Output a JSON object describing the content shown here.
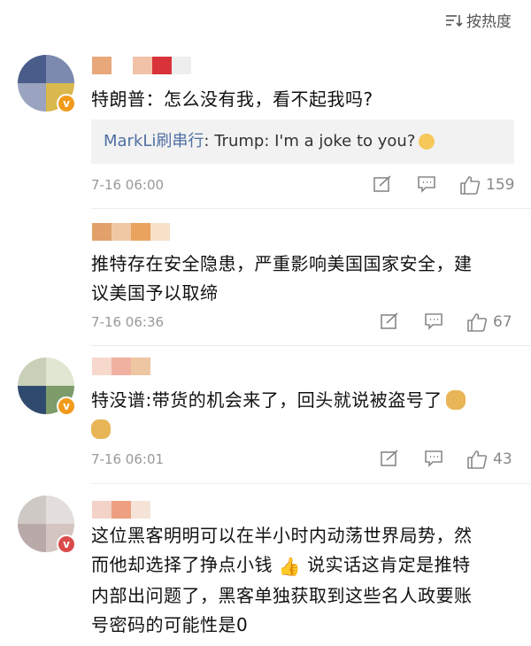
{
  "header": {
    "sort_label": "按热度"
  },
  "comments": [
    {
      "text": "特朗普：怎么没有我，看不起我吗?",
      "reply": {
        "name": "MarkLi刷串行",
        "text": ": Trump: I'm a joke to you?"
      },
      "time": "7-16 06:00",
      "likes": "159"
    },
    {
      "text_line1": "推特存在安全隐患，严重影响美国国家安全，建",
      "text_line2": "议美国予以取缔",
      "time": "7-16 06:36",
      "likes": "67"
    },
    {
      "text": "特没谱:带货的机会来了，回头就说被盗号了",
      "time": "7-16 06:01",
      "likes": "43"
    },
    {
      "text_line1": "这位黑客明明可以在半小时内动荡世界局势，然",
      "text_line2a": "而他却选择了挣点小钱",
      "text_line2b": "说实话这肯定是推特",
      "text_line3": "内部出问题了，黑客单独获取到这些名人政要账",
      "text_line4": "号密码的可能性是0"
    }
  ],
  "icons": {
    "sort": "sort-icon",
    "share": "share-icon",
    "comment": "comment-icon",
    "like": "thumbs-up-icon"
  },
  "colors": {
    "reply_name": "#4f6fa3",
    "vip_badge": "#f19a1b",
    "meta_gray": "#999999"
  }
}
